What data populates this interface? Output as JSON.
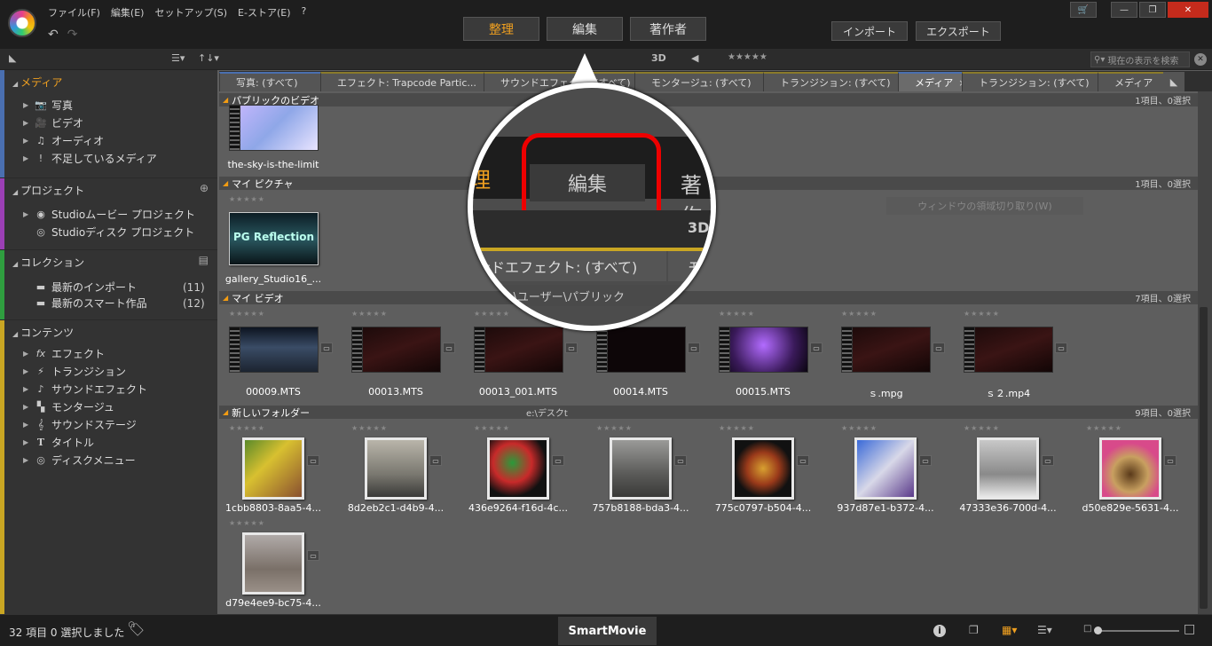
{
  "menu": {
    "file": "ファイル(F)",
    "edit": "編集(E)",
    "setup": "セットアップ(S)",
    "estore": "E-ストア(E)",
    "help": "?"
  },
  "undo": {
    "undo": "↶",
    "redo": "↷"
  },
  "modes": {
    "organize": "整理",
    "edit": "編集",
    "author": "著作者"
  },
  "io": {
    "import": "インポート",
    "export": "エクスポート"
  },
  "window": {
    "cart": "🛒",
    "min": "—",
    "max": "❐",
    "close": "✕"
  },
  "toolbar": {
    "list_icon": "☰▾",
    "sort_icon": "↑↓▾",
    "mode3d": "3D",
    "tag": "◀",
    "stars": "★★★★★",
    "search_placeholder": "現在の表示を検索",
    "clear": "✕"
  },
  "sidebar": {
    "media": {
      "title": "メディア",
      "items": [
        {
          "label": "写真",
          "icon": "📷"
        },
        {
          "label": "ビデオ",
          "icon": "🎥"
        },
        {
          "label": "オーディオ",
          "icon": "♫"
        },
        {
          "label": "不足しているメディア",
          "icon": "!"
        }
      ]
    },
    "project": {
      "title": "プロジェクト",
      "items": [
        {
          "label": "Studioムービー プロジェクト",
          "icon": "◉"
        },
        {
          "label": "Studioディスク プロジェクト",
          "icon": "◎"
        }
      ]
    },
    "collection": {
      "title": "コレクション",
      "items": [
        {
          "label": "最新のインポート",
          "count": "(11)",
          "icon": "▬"
        },
        {
          "label": "最新のスマート作品",
          "count": "(12)",
          "icon": "▬"
        }
      ]
    },
    "contents": {
      "title": "コンテンツ",
      "items": [
        {
          "label": "エフェクト",
          "icon": "fx"
        },
        {
          "label": "トランジション",
          "icon": "⚡"
        },
        {
          "label": "サウンドエフェクト",
          "icon": "♪"
        },
        {
          "label": "モンタージュ",
          "icon": "▚"
        },
        {
          "label": "サウンドステージ",
          "icon": "𝄞"
        },
        {
          "label": "タイトル",
          "icon": "T"
        },
        {
          "label": "ディスクメニュー",
          "icon": "◎"
        }
      ]
    }
  },
  "tabs": [
    {
      "label": "写真: (すべて)"
    },
    {
      "label": "エフェクト: Trapcode Partic..."
    },
    {
      "label": "サウンドエフェクト: (すべて)"
    },
    {
      "label": "モンタージュ: (すべて)"
    },
    {
      "label": "トランジション: (すべて)"
    },
    {
      "label": "メディア",
      "close": "×"
    },
    {
      "label": "トランジション: (すべて)"
    },
    {
      "label": "メディア"
    }
  ],
  "groups": {
    "public_video": {
      "title": "パブリックのビデオ",
      "count": "1項目、0選択"
    },
    "my_pictures": {
      "title": "マイ ピクチャ",
      "count": "1項目、0選択"
    },
    "my_video": {
      "title": "マイ ビデオ",
      "count": "7項目、0選択"
    },
    "new_folder": {
      "title": "新しいフォルダー",
      "path": "e:\\デスクt",
      "count": "9項目、0選択"
    }
  },
  "items": {
    "public_video": [
      "the-sky-is-the-limit"
    ],
    "my_pictures": [
      "gallery_Studio16_..."
    ],
    "my_video": [
      "00009.MTS",
      "00013.MTS",
      "00013_001.MTS",
      "00014.MTS",
      "00015.MTS",
      "ｓ.mpg",
      "ｓ２.mp4"
    ],
    "new_folder": [
      "1cbb8803-8aa5-4...",
      "8d2eb2c1-d4b9-4...",
      "436e9264-f16d-4c...",
      "757b8188-bda3-4...",
      "775c0797-b504-4...",
      "937d87e1-b372-4...",
      "47333e36-700d-4...",
      "d50e829e-5631-4...",
      "d79e4ee9-bc75-4..."
    ]
  },
  "star_glyphs": "★★★★★",
  "folder_glyph": "▭",
  "gallery_text": "PG Reflection",
  "magnifier": {
    "tab_left": "理",
    "tab_center": "編集",
    "tab_right": "著作",
    "mode3d": "3D",
    "tab_line": "ンドエフェクト: (すべて)",
    "tab_line_right": "モ",
    "path": "C:\\ユーザー\\パブリック"
  },
  "ghost_button": "ウィンドウの領域切り取り(W)",
  "status": {
    "text": "32 項目 0 選択しました",
    "smart": "SmartMovie",
    "info": "i",
    "copy": "❐",
    "grid": "▦▾",
    "list": "☰▾",
    "small": "□",
    "large": "□"
  }
}
